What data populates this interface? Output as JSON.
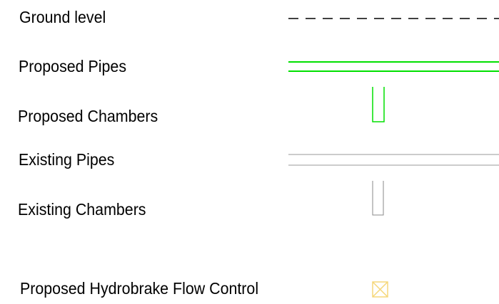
{
  "legend": {
    "items": [
      {
        "label": "Ground level",
        "symbol": "dashed-line-icon",
        "color": "#000000"
      },
      {
        "label": "Proposed Pipes",
        "symbol": "double-line-icon",
        "color": "#00e000"
      },
      {
        "label": "Proposed Chambers",
        "symbol": "chamber-icon",
        "color": "#00e000"
      },
      {
        "label": "Existing Pipes",
        "symbol": "double-line-icon",
        "color": "#999999"
      },
      {
        "label": "Existing Chambers",
        "symbol": "chamber-icon",
        "color": "#888888"
      },
      {
        "label": "Proposed Hydrobrake Flow Control",
        "symbol": "crossed-box-icon",
        "color": "#f5d77a"
      }
    ]
  }
}
